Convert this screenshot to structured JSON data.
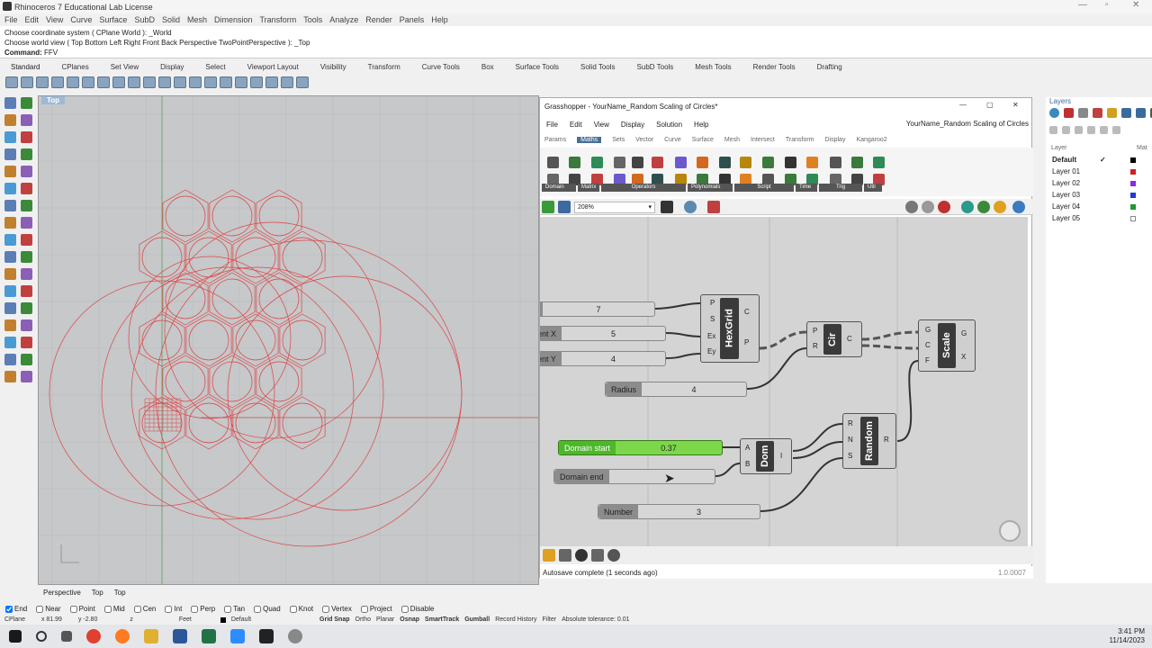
{
  "app": {
    "title": "Rhinoceros 7 Educational Lab License"
  },
  "menu": [
    "File",
    "Edit",
    "View",
    "Curve",
    "Surface",
    "SubD",
    "Solid",
    "Mesh",
    "Dimension",
    "Transform",
    "Tools",
    "Analyze",
    "Render",
    "Panels",
    "Help"
  ],
  "command": {
    "line1": "Choose coordinate system ( CPlane  World ): _World",
    "line2": "Choose world view ( Top  Bottom  Left  Right  Front  Back  Perspective  TwoPointPerspective ): _Top",
    "prompt_label": "Command:",
    "prompt_value": "FFV"
  },
  "toolbar_tabs": [
    "Standard",
    "CPlanes",
    "Set View",
    "Display",
    "Select",
    "Viewport Layout",
    "Visibility",
    "Transform",
    "Curve Tools",
    "Box",
    "Surface Tools",
    "Solid Tools",
    "SubD Tools",
    "Mesh Tools",
    "Render Tools",
    "Drafting"
  ],
  "viewport": {
    "label": "Top",
    "tabs": [
      "Perspective",
      "Top",
      "Top"
    ]
  },
  "grasshopper": {
    "title": "Grasshopper - YourName_Random Scaling of Circles*",
    "doc_name": "YourName_Random Scaling of Circles",
    "menu": [
      "File",
      "Edit",
      "View",
      "Display",
      "Solution",
      "Help"
    ],
    "tabs": [
      "Params",
      "Maths",
      "Sets",
      "Vector",
      "Curve",
      "Surface",
      "Mesh",
      "Intersect",
      "Transform",
      "Display",
      "Kangaroo2"
    ],
    "groups": [
      "Domain",
      "Matrix",
      "Operators",
      "Polynomials",
      "Script",
      "Time",
      "Trig",
      "Util"
    ],
    "zoom": "208%",
    "sliders": [
      {
        "label": "",
        "value": "7"
      },
      {
        "label": "ent X",
        "value": "5"
      },
      {
        "label": "ent Y",
        "value": "4"
      },
      {
        "label": "Radius",
        "value": "4"
      },
      {
        "label": "Domain start",
        "value": "0.37"
      },
      {
        "label": "Domain end",
        "value": ""
      },
      {
        "label": "Number",
        "value": "3"
      }
    ],
    "components": {
      "hexgrid": {
        "name": "HexGrid",
        "inputs": [
          "P",
          "S",
          "Ex",
          "Ey"
        ],
        "outputs": [
          "C",
          "P"
        ]
      },
      "circle": {
        "name": "Cir",
        "inputs": [
          "P",
          "R"
        ],
        "outputs": [
          "C"
        ]
      },
      "scale": {
        "name": "Scale",
        "inputs": [
          "G",
          "C",
          "F"
        ],
        "outputs": [
          "G",
          "X"
        ]
      },
      "domain": {
        "name": "Dom",
        "inputs": [
          "A",
          "B"
        ],
        "outputs": [
          "I"
        ]
      },
      "random": {
        "name": "Random",
        "inputs": [
          "R",
          "N",
          "S"
        ],
        "outputs": [
          "R"
        ]
      }
    },
    "status": "Autosave complete (1 seconds ago)",
    "version": "1.0.0007"
  },
  "layers": {
    "title": "Layers",
    "col_layer": "Layer",
    "col_mat": "Mat",
    "items": [
      {
        "name": "Default",
        "current": true,
        "color": "#000000"
      },
      {
        "name": "Layer 01",
        "color": "#d61f1f"
      },
      {
        "name": "Layer 02",
        "color": "#8a2be2"
      },
      {
        "name": "Layer 03",
        "color": "#1f3bd6"
      },
      {
        "name": "Layer 04",
        "color": "#1f9a2e"
      },
      {
        "name": "Layer 05",
        "color": "#ffffff"
      }
    ]
  },
  "osnaps": [
    "End",
    "Near",
    "Point",
    "Mid",
    "Cen",
    "Int",
    "Perp",
    "Tan",
    "Quad",
    "Knot",
    "Vertex",
    "Project",
    "Disable"
  ],
  "statusbar": {
    "cplane": "CPlane",
    "x": "x 81.99",
    "y": "y -2.80",
    "z": "z",
    "units": "Feet",
    "layer": "Default",
    "toggles": [
      "Grid Snap",
      "Ortho",
      "Planar",
      "Osnap",
      "SmartTrack",
      "Gumball",
      "Record History",
      "Filter"
    ],
    "tolerance": "Absolute tolerance: 0.01"
  },
  "clock": {
    "time": "3:41 PM",
    "date": "11/14/2023"
  }
}
